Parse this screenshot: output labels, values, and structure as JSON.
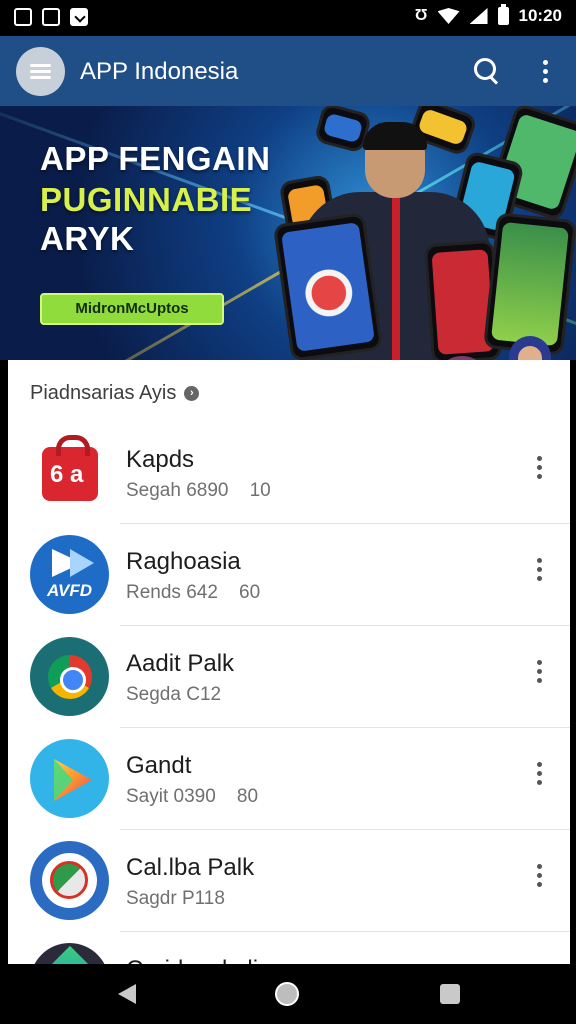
{
  "status_bar": {
    "time": "10:20",
    "left_icons": [
      "sim-icon",
      "message-icon",
      "check-icon"
    ],
    "right_icons": [
      "alarm-icon",
      "wifi-icon",
      "signal-icon",
      "battery-icon"
    ]
  },
  "app_bar": {
    "title": "APP Indonesia"
  },
  "banner": {
    "line1": "APP FENGAIN",
    "line2": "PUGINNABIE",
    "line3": "ARYK",
    "cta": "MidronMcUptos",
    "colors": {
      "line2": "#d8f04a",
      "cta_bg": "#8fdc3c"
    }
  },
  "section": {
    "title": "Piadnsarias Ayis"
  },
  "apps": [
    {
      "name": "Kapds",
      "meta": "Segah 6890    10",
      "icon": "shopping-bag-icon"
    },
    {
      "name": "Raghoasia",
      "meta": "Rends 642    60",
      "icon": "play-video-icon"
    },
    {
      "name": "Aadit Palk",
      "meta": "Segda C12",
      "icon": "browser-ring-icon"
    },
    {
      "name": "Gandt",
      "meta": "Sayit 0390    80",
      "icon": "play-store-icon"
    },
    {
      "name": "Cal.lba Palk",
      "meta": "Sagdr P118",
      "icon": "maps-icon"
    },
    {
      "name": "Caridasokulia",
      "meta": "",
      "icon": "gem-icon"
    }
  ],
  "accent_color": "#1f4f86"
}
